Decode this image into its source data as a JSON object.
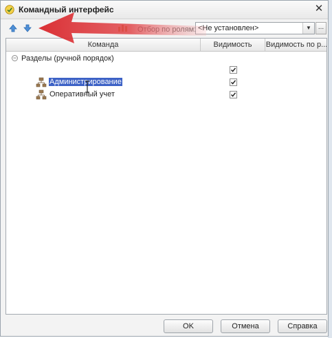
{
  "window": {
    "title": "Командный интерфейс",
    "close_label": "✕"
  },
  "toolbar": {
    "move_up_icon": "arrow-up-icon",
    "move_down_icon": "arrow-down-icon",
    "filter_label": "Отбор по ролям:",
    "filter_value": "<Не установлен>",
    "dropdown_glyph": "▼",
    "ellipsis_label": "..."
  },
  "table": {
    "columns": [
      "Команда",
      "Видимость",
      "Видимость по р..."
    ],
    "rows": [
      {
        "label": "Разделы (ручной порядок)",
        "type": "group",
        "checked": true
      },
      {
        "label": "Администрирование",
        "type": "item",
        "checked": true,
        "selected": true
      },
      {
        "label": "Оперативный учет",
        "type": "item",
        "checked": true,
        "selected": false
      }
    ]
  },
  "footer": {
    "ok_label": "OK",
    "cancel_label": "Отмена",
    "help_label": "Справка"
  },
  "colors": {
    "selection": "#3d62c6",
    "annotation_arrow": "#d9262b"
  }
}
